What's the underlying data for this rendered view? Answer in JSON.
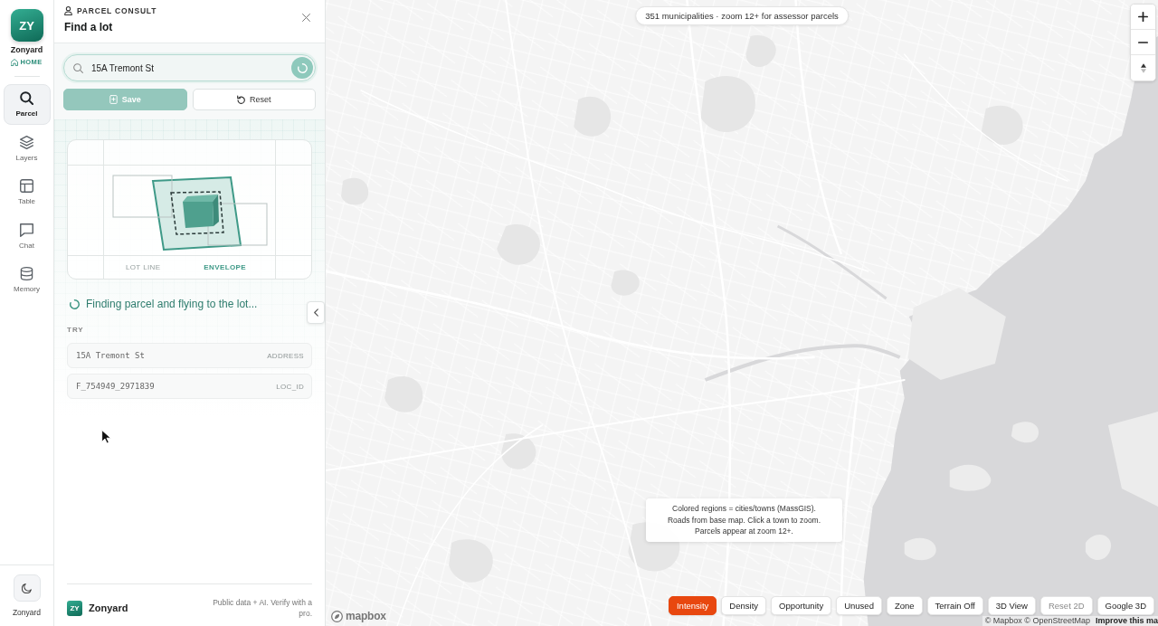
{
  "rail": {
    "logo": "ZY",
    "brand": "Zonyard",
    "home": "HOME",
    "items": [
      {
        "label": "Parcel",
        "selected": true
      },
      {
        "label": "Layers",
        "selected": false
      },
      {
        "label": "Table",
        "selected": false
      },
      {
        "label": "Chat",
        "selected": false
      },
      {
        "label": "Memory",
        "selected": false
      }
    ],
    "footer_label": "Zonyard"
  },
  "panel": {
    "eyebrow": "PARCEL CONSULT",
    "title": "Find a lot",
    "search": {
      "value": "15A Tremont St"
    },
    "buttons": [
      {
        "label": "Save",
        "disabled": true
      },
      {
        "label": "Reset",
        "disabled": false
      }
    ],
    "diagram": {
      "labels": [
        "LOT LINE",
        "ENVELOPE"
      ]
    },
    "status": "Finding parcel and flying to the lot...",
    "try_heading": "TRY",
    "suggestions": [
      {
        "value": "15A Tremont St",
        "type": "ADDRESS"
      },
      {
        "value": "F_754949_2971839",
        "type": "LOC_ID"
      }
    ],
    "footer": {
      "logo": "ZY",
      "brand": "Zonyard",
      "note": "Public data + AI. Verify with a pro."
    }
  },
  "map": {
    "banner": "351 municipalities · zoom 12+ for assessor parcels",
    "legend": [
      "Colored regions = cities/towns (MassGIS).",
      "Roads from base map. Click a town to zoom.",
      "Parcels appear at zoom 12+."
    ],
    "controls": [
      {
        "label": "Intensity",
        "selected": true,
        "disabled": false
      },
      {
        "label": "Density",
        "selected": false,
        "disabled": false
      },
      {
        "label": "Opportunity",
        "selected": false,
        "disabled": false
      },
      {
        "label": "Unused",
        "selected": false,
        "disabled": false
      },
      {
        "label": "Zone",
        "selected": false,
        "disabled": false
      },
      {
        "label": "Terrain Off",
        "selected": false,
        "disabled": false
      },
      {
        "label": "3D View",
        "selected": false,
        "disabled": false
      },
      {
        "label": "Reset 2D",
        "selected": false,
        "disabled": true
      },
      {
        "label": "Google 3D",
        "selected": false,
        "disabled": false
      }
    ],
    "logo": "mapbox",
    "attribution": "© Mapbox © OpenStreetMap",
    "attribution_link": "Improve this ma"
  }
}
